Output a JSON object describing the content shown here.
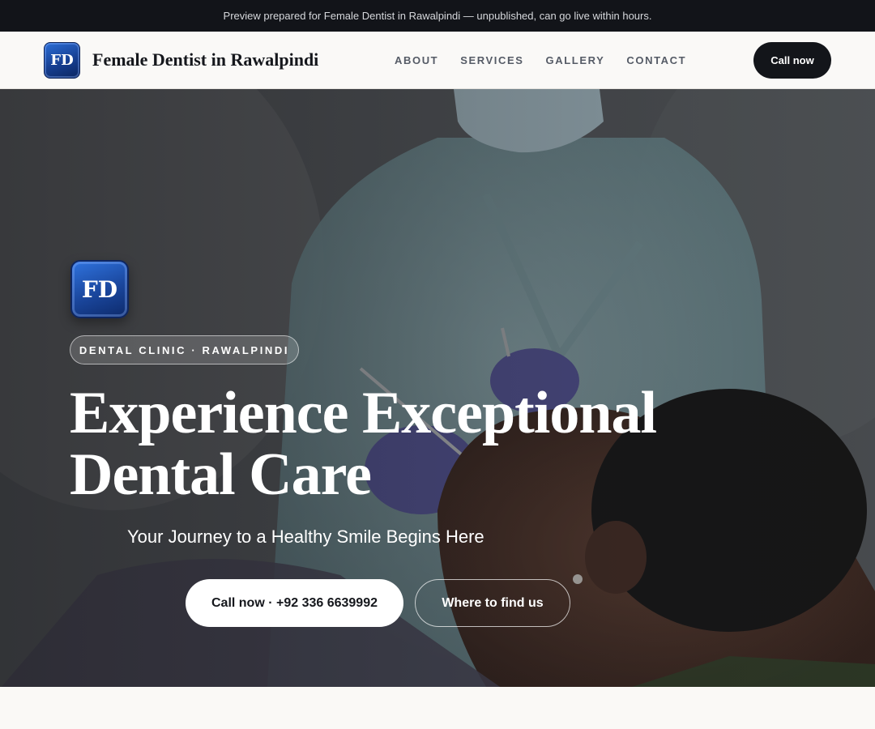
{
  "topbar": {
    "text": "Preview prepared for Female Dentist in Rawalpindi — unpublished, can go live within hours."
  },
  "header": {
    "logo_text": "FD",
    "site_name": "Female Dentist in Rawalpindi",
    "nav": [
      "ABOUT",
      "SERVICES",
      "GALLERY",
      "CONTACT"
    ],
    "cta_label": "Call now"
  },
  "hero": {
    "logo_text": "FD",
    "badge": "DENTAL CLINIC · RAWALPINDI",
    "headline_line1": "Experience Exceptional",
    "headline_line2": "Dental Care",
    "subheadline": "Your Journey to a Healthy Smile Begins Here",
    "primary_button": "Call now · +92 336 6639992",
    "secondary_button": "Where to find us"
  },
  "colors": {
    "dark": "#13151a",
    "logo_blue": "#1a469c",
    "page_bg": "#f8f7f4"
  }
}
